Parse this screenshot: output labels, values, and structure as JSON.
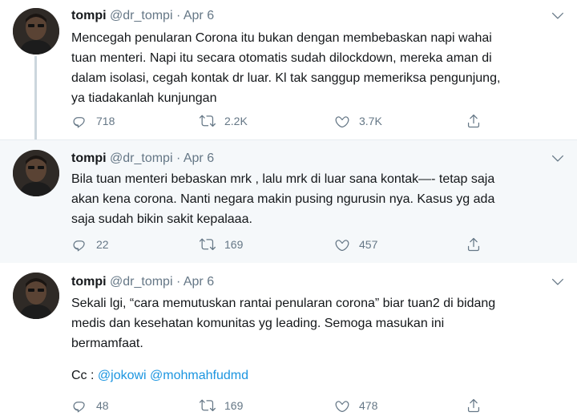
{
  "tweets": [
    {
      "name": "tompi",
      "handle": "@dr_tompi",
      "sep": "·",
      "date": "Apr 6",
      "lines": [
        "Mencegah penularan Corona itu bukan dengan membebaskan napi wahai",
        "tuan menteri. Napi itu secara otomatis sudah dilockdown, mereka aman di",
        "dalam isolasi, cegah kontak dr luar. Kl tak sanggup memeriksa pengunjung,",
        "ya tiadakanlah kunjungan"
      ],
      "replies": "718",
      "retweets": "2.2K",
      "likes": "3.7K"
    },
    {
      "name": "tompi",
      "handle": "@dr_tompi",
      "sep": "·",
      "date": "Apr 6",
      "lines": [
        "Bila tuan menteri bebaskan mrk , lalu mrk di luar sana kontak—- tetap saja",
        "akan kena corona. Nanti negara makin pusing ngurusin nya.  Kasus yg ada",
        "saja sudah bikin sakit kepalaaa."
      ],
      "replies": "22",
      "retweets": "169",
      "likes": "457"
    },
    {
      "name": "tompi",
      "handle": "@dr_tompi",
      "sep": "·",
      "date": "Apr 6",
      "lines": [
        "Sekali lgi, “cara memutuskan rantai penularan corona”  biar tuan2 di bidang",
        "medis dan kesehatan komunitas yg leading. Semoga masukan ini",
        "bermamfaat."
      ],
      "cc_label": "Cc : ",
      "mention1": "@jokowi",
      "mention2": "@mohmahfudmd",
      "replies": "48",
      "retweets": "169",
      "likes": "478"
    }
  ],
  "icons": {
    "reply": "reply-icon",
    "retweet": "retweet-icon",
    "like": "heart-icon",
    "share": "share-icon",
    "caret": "chevron-down-icon"
  },
  "colors": {
    "text": "#14171a",
    "muted": "#657786",
    "link": "#1b95e0",
    "thread_line": "#ccd6dd",
    "highlight_bg": "#f5f8fa"
  }
}
